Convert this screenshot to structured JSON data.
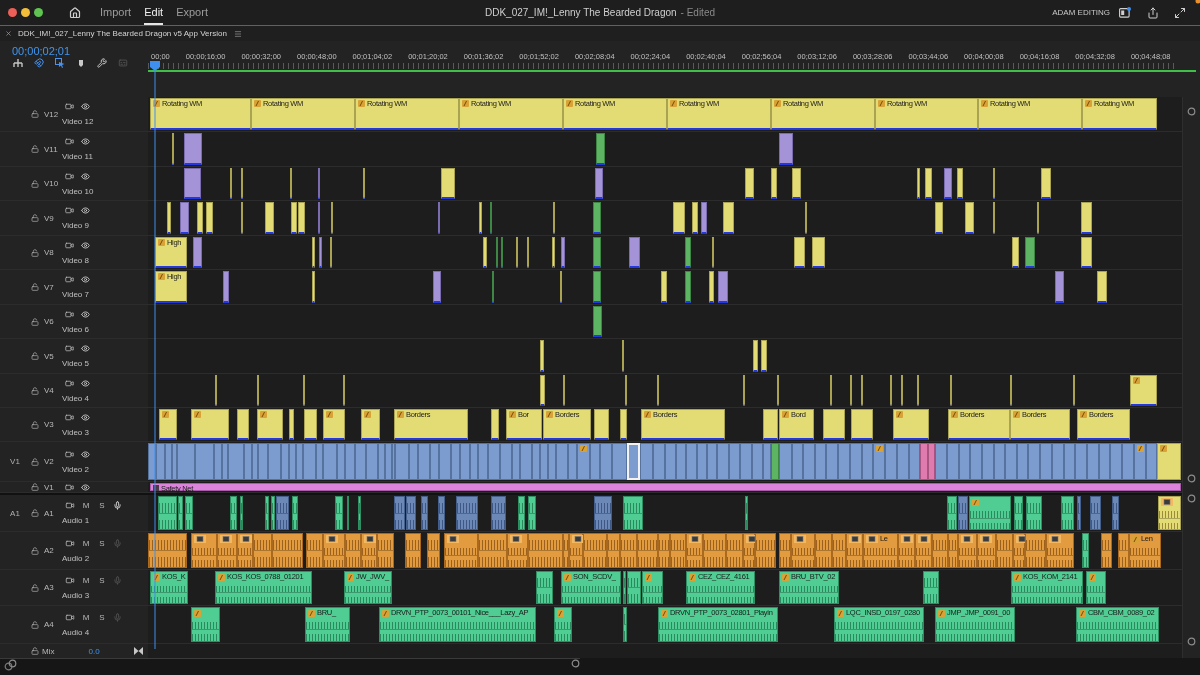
{
  "app_bar": {
    "tabs": [
      {
        "label": "Import",
        "selected": false
      },
      {
        "label": "Edit",
        "selected": true
      },
      {
        "label": "Export",
        "selected": false
      }
    ],
    "document_title": "DDK_027_IM!_Lenny The Bearded Dragon",
    "document_status": "- Edited",
    "workspace": "ADAM EDITING"
  },
  "sequence_tab": {
    "title": "DDK_IM!_027_Lenny The Bearded Dragon v5 App Version"
  },
  "timeline": {
    "playhead_timecode": "00;00;02;01",
    "ruler_labels": [
      "00;00",
      "00;00;16;00",
      "00;00;32;00",
      "00;00;48;00",
      "00;01;04;02",
      "00;01;20;02",
      "00;01;36;02",
      "00;01;52;02",
      "00;02;08;04",
      "00;02;24;04",
      "00;02;40;04",
      "00;02;56;04",
      "00;03;12;06",
      "00;03;28;06",
      "00;03;44;06",
      "00;04;00;08",
      "00;04;16;08",
      "00;04;32;08",
      "00;04;48;08"
    ],
    "video_tracks": [
      {
        "target": "V12",
        "name": "Video 12",
        "clips": [
          {
            "label": "Rotating WM"
          },
          {
            "label": "Rotating WM"
          },
          {
            "label": "Rotating WM"
          },
          {
            "label": "Rotating WM"
          },
          {
            "label": "Rotating WM"
          },
          {
            "label": "Rotating WM"
          },
          {
            "label": "Rotating WM"
          },
          {
            "label": "Rotating WM"
          },
          {
            "label": "Rotating WM"
          },
          {
            "label": "Rotating WM"
          }
        ]
      },
      {
        "target": "V11",
        "name": "Video 11"
      },
      {
        "target": "V10",
        "name": "Video 10"
      },
      {
        "target": "V9",
        "name": "Video 9"
      },
      {
        "target": "V8",
        "name": "Video 8",
        "clips": [
          {
            "label": "High"
          }
        ]
      },
      {
        "target": "V7",
        "name": "Video 7",
        "clips": [
          {
            "label": "High"
          }
        ]
      },
      {
        "target": "V6",
        "name": "Video 6"
      },
      {
        "target": "V5",
        "name": "Video 5"
      },
      {
        "target": "V4",
        "name": "Video 4"
      },
      {
        "target": "V3",
        "name": "Video 3",
        "clips": [
          {
            "label": "Borders"
          },
          {
            "label": "Bor"
          },
          {
            "label": "Borders"
          },
          {
            "label": "Borders"
          },
          {
            "label": "Bord"
          },
          {
            "label": "Borders"
          },
          {
            "label": "Borders"
          },
          {
            "label": "Borders"
          }
        ]
      },
      {
        "source": "V1",
        "target": "V2",
        "name": "Video 2"
      },
      {
        "target": "V1",
        "clips": [
          {
            "label": "Safety Net"
          }
        ]
      }
    ],
    "audio_tracks": [
      {
        "source": "A1",
        "target": "A1",
        "name": "Audio 1",
        "mute": "M",
        "solo": "S",
        "mic_enabled": true
      },
      {
        "target": "A2",
        "name": "Audio 2",
        "mute": "M",
        "solo": "S",
        "mic_enabled": false,
        "clips": [
          {
            "label": "Le"
          },
          {
            "label": "Len"
          }
        ]
      },
      {
        "target": "A3",
        "name": "Audio 3",
        "mute": "M",
        "solo": "S",
        "mic_enabled": false,
        "clips": [
          {
            "label": "KOS_K"
          },
          {
            "label": "KOS_KOS_0788_01201"
          },
          {
            "label": "JW_JWV_"
          },
          {
            "label": "SON_SCDV_"
          },
          {
            "label": "CEZ_CEZ_4161"
          },
          {
            "label": "BRU_BTV_02"
          },
          {
            "label": "KOS_KOM_2141"
          }
        ]
      },
      {
        "target": "A4",
        "name": "Audio 4",
        "mute": "M",
        "solo": "S",
        "mic_enabled": false,
        "clips": [
          {
            "label": "BRU_"
          },
          {
            "label": "DRVN_PTP_0073_00101_Nice___Lazy_AP"
          },
          {
            "label": "DRVN_PTP_0073_02801_Playin"
          },
          {
            "label": "LQC_INSD_0197_0280"
          },
          {
            "label": "JMP_JMP_0091_00"
          },
          {
            "label": "CBM_CBM_0089_02"
          }
        ]
      }
    ],
    "mix": {
      "label": "Mix",
      "value": "0.0"
    }
  }
}
